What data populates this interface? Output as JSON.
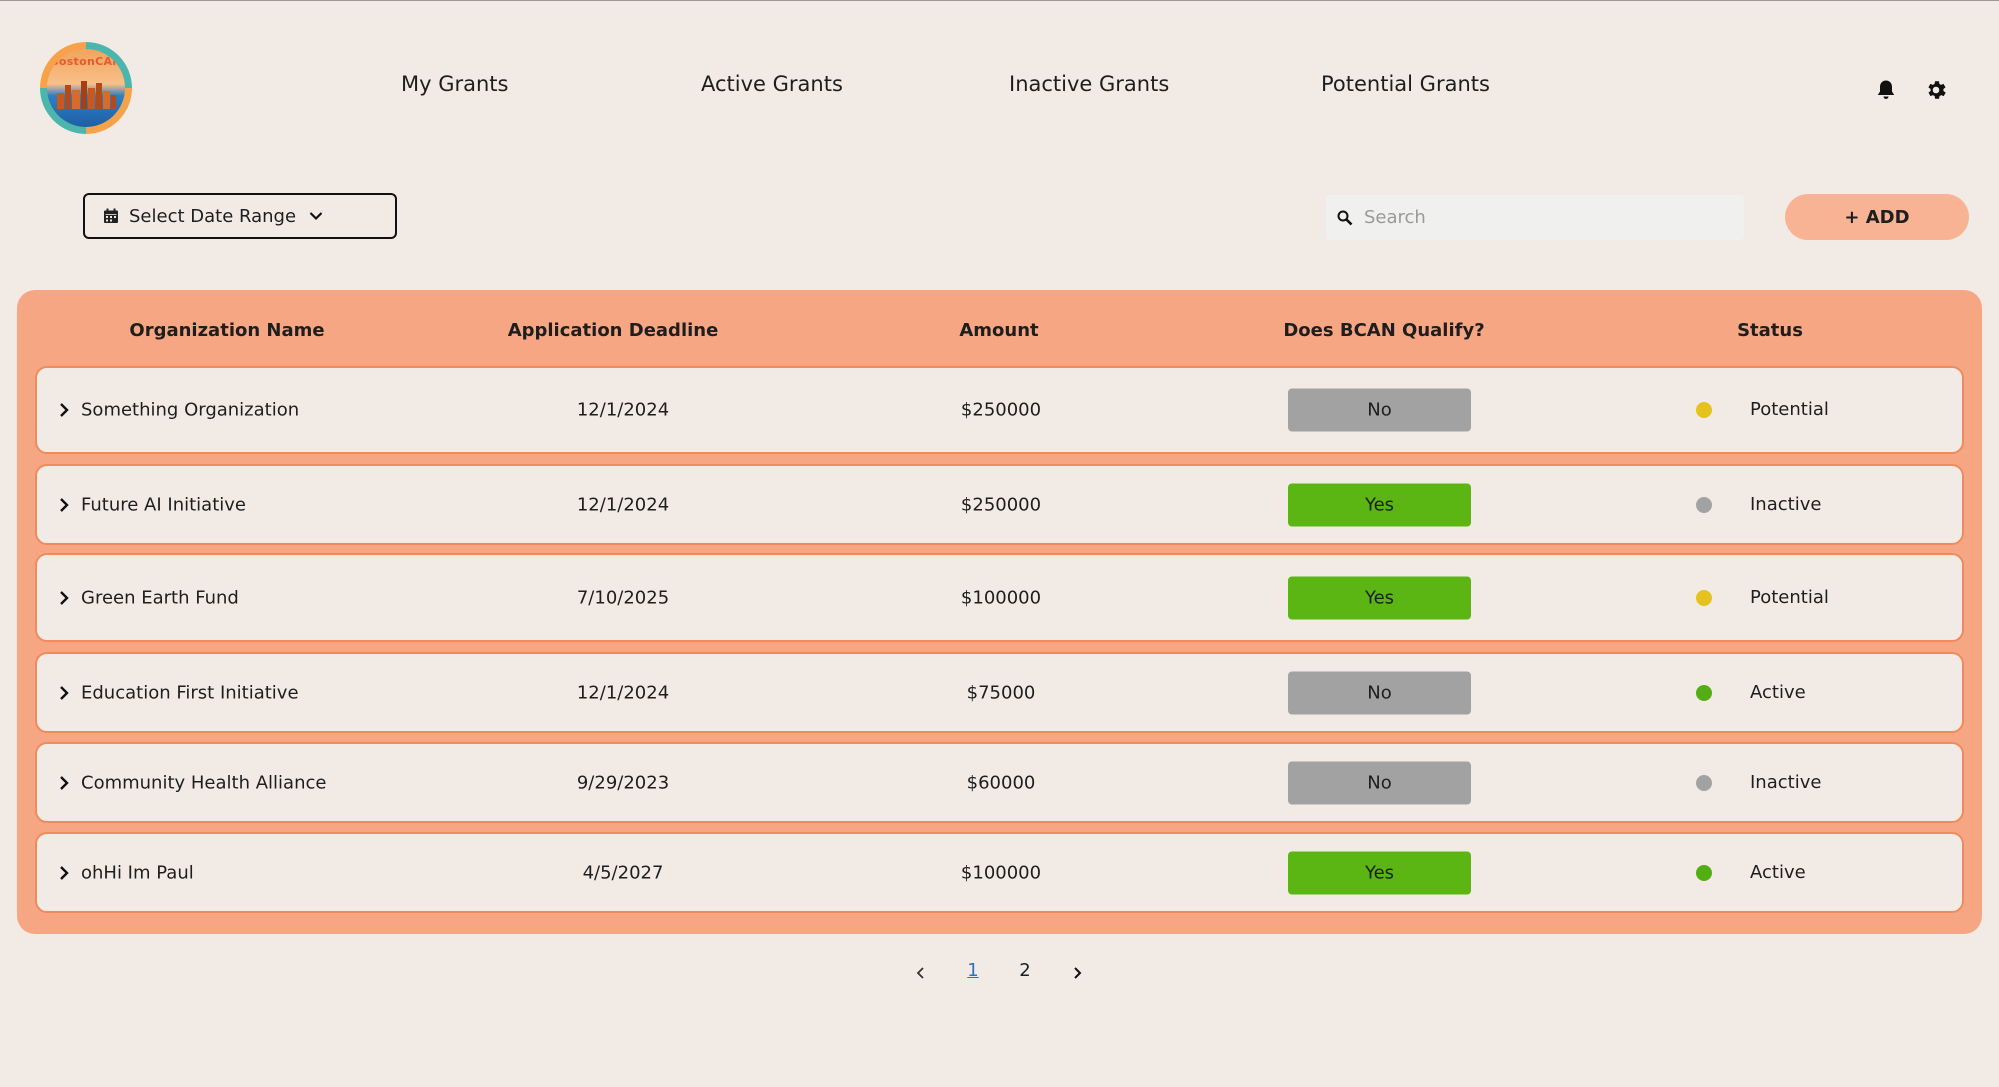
{
  "logo": {
    "text": "BostonCAN",
    "icon": "bostoncan-logo"
  },
  "nav": {
    "items": [
      {
        "label": "My Grants"
      },
      {
        "label": "Active Grants"
      },
      {
        "label": "Inactive Grants"
      },
      {
        "label": "Potential Grants"
      }
    ],
    "icons": [
      "bell-icon",
      "gear-icon"
    ]
  },
  "toolbar": {
    "date_range_label": "Select Date Range",
    "search_placeholder": "Search",
    "search_value": "",
    "add_label": "+ ADD"
  },
  "table": {
    "headers": {
      "org": "Organization Name",
      "deadline": "Application Deadline",
      "amount": "Amount",
      "qualify": "Does BCAN Qualify?",
      "status": "Status"
    },
    "rows": [
      {
        "org": "Something Organization",
        "deadline": "12/1/2024",
        "amount": "$250000",
        "qualify": "No",
        "status": "Potential",
        "status_color": "#E5C21E"
      },
      {
        "org": "Future AI Initiative",
        "deadline": "12/1/2024",
        "amount": "$250000",
        "qualify": "Yes",
        "status": "Inactive",
        "status_color": "#A3A2A2"
      },
      {
        "org": "Green Earth Fund",
        "deadline": "7/10/2025",
        "amount": "$100000",
        "qualify": "Yes",
        "status": "Potential",
        "status_color": "#E5C21E"
      },
      {
        "org": "Education First Initiative",
        "deadline": "12/1/2024",
        "amount": "$75000",
        "qualify": "No",
        "status": "Active",
        "status_color": "#52AE12"
      },
      {
        "org": "Community Health Alliance",
        "deadline": "9/29/2023",
        "amount": "$60000",
        "qualify": "No",
        "status": "Inactive",
        "status_color": "#A3A2A2"
      },
      {
        "org": "ohHi Im Paul",
        "deadline": "4/5/2027",
        "amount": "$100000",
        "qualify": "Yes",
        "status": "Active",
        "status_color": "#52AE12"
      }
    ]
  },
  "pagination": {
    "pages": [
      "1",
      "2"
    ],
    "current": "1"
  },
  "colors": {
    "background": "#F2EBE5",
    "panel": "#F7A683",
    "row_border": "#F08A5D",
    "yes": "#5BB513",
    "no": "#A3A2A2",
    "add_button": "#F7B394"
  }
}
